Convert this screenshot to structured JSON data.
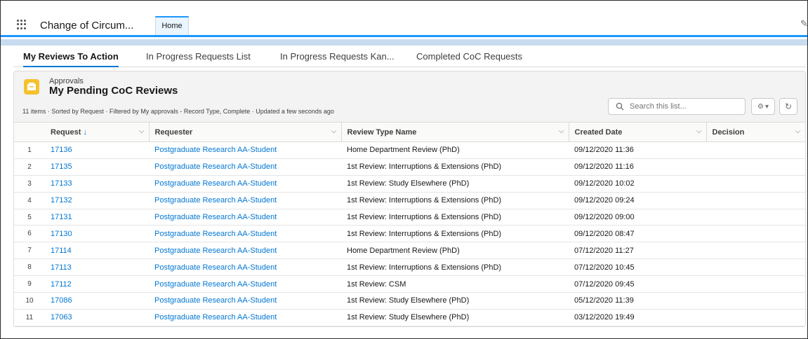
{
  "app": {
    "name": "Change of Circum...",
    "nav_tab": "Home"
  },
  "page_tabs": [
    {
      "label": "My Reviews To Action",
      "active": true
    },
    {
      "label": "In Progress Requests List",
      "active": false
    },
    {
      "label": "In Progress Requests Kan...",
      "active": false
    },
    {
      "label": "Completed CoC Requests",
      "active": false
    }
  ],
  "list": {
    "eyebrow": "Approvals",
    "title": "My Pending CoC Reviews",
    "info": "11 items · Sorted by Request · Filtered by My approvals - Record Type, Complete · Updated a few seconds ago",
    "search_placeholder": "Search this list...",
    "accent_color": "#f5c12e"
  },
  "columns": [
    "Request",
    "Requester",
    "Review Type Name",
    "Created Date",
    "Decision"
  ],
  "rows": [
    {
      "num": "1",
      "request": "17136",
      "requester": "Postgraduate Research AA-Student",
      "review_type": "Home Department Review (PhD)",
      "created": "09/12/2020 11:36",
      "decision": ""
    },
    {
      "num": "2",
      "request": "17135",
      "requester": "Postgraduate Research AA-Student",
      "review_type": "1st Review: Interruptions & Extensions (PhD)",
      "created": "09/12/2020 11:16",
      "decision": ""
    },
    {
      "num": "3",
      "request": "17133",
      "requester": "Postgraduate Research AA-Student",
      "review_type": "1st Review: Study Elsewhere (PhD)",
      "created": "09/12/2020 10:02",
      "decision": ""
    },
    {
      "num": "4",
      "request": "17132",
      "requester": "Postgraduate Research AA-Student",
      "review_type": "1st Review: Interruptions & Extensions (PhD)",
      "created": "09/12/2020 09:24",
      "decision": ""
    },
    {
      "num": "5",
      "request": "17131",
      "requester": "Postgraduate Research AA-Student",
      "review_type": "1st Review: Interruptions & Extensions (PhD)",
      "created": "09/12/2020 09:00",
      "decision": ""
    },
    {
      "num": "6",
      "request": "17130",
      "requester": "Postgraduate Research AA-Student",
      "review_type": "1st Review: Interruptions & Extensions (PhD)",
      "created": "09/12/2020 08:47",
      "decision": ""
    },
    {
      "num": "7",
      "request": "17114",
      "requester": "Postgraduate Research AA-Student",
      "review_type": "Home Department Review (PhD)",
      "created": "07/12/2020 11:27",
      "decision": ""
    },
    {
      "num": "8",
      "request": "17113",
      "requester": "Postgraduate Research AA-Student",
      "review_type": "1st Review: Interruptions & Extensions (PhD)",
      "created": "07/12/2020 10:45",
      "decision": ""
    },
    {
      "num": "9",
      "request": "17112",
      "requester": "Postgraduate Research AA-Student",
      "review_type": "1st Review: CSM",
      "created": "07/12/2020 09:45",
      "decision": ""
    },
    {
      "num": "10",
      "request": "17086",
      "requester": "Postgraduate Research AA-Student",
      "review_type": "1st Review: Study Elsewhere (PhD)",
      "created": "05/12/2020 11:39",
      "decision": ""
    },
    {
      "num": "11",
      "request": "17063",
      "requester": "Postgraduate Research AA-Student",
      "review_type": "1st Review: Study Elsewhere (PhD)",
      "created": "03/12/2020 19:49",
      "decision": ""
    }
  ]
}
